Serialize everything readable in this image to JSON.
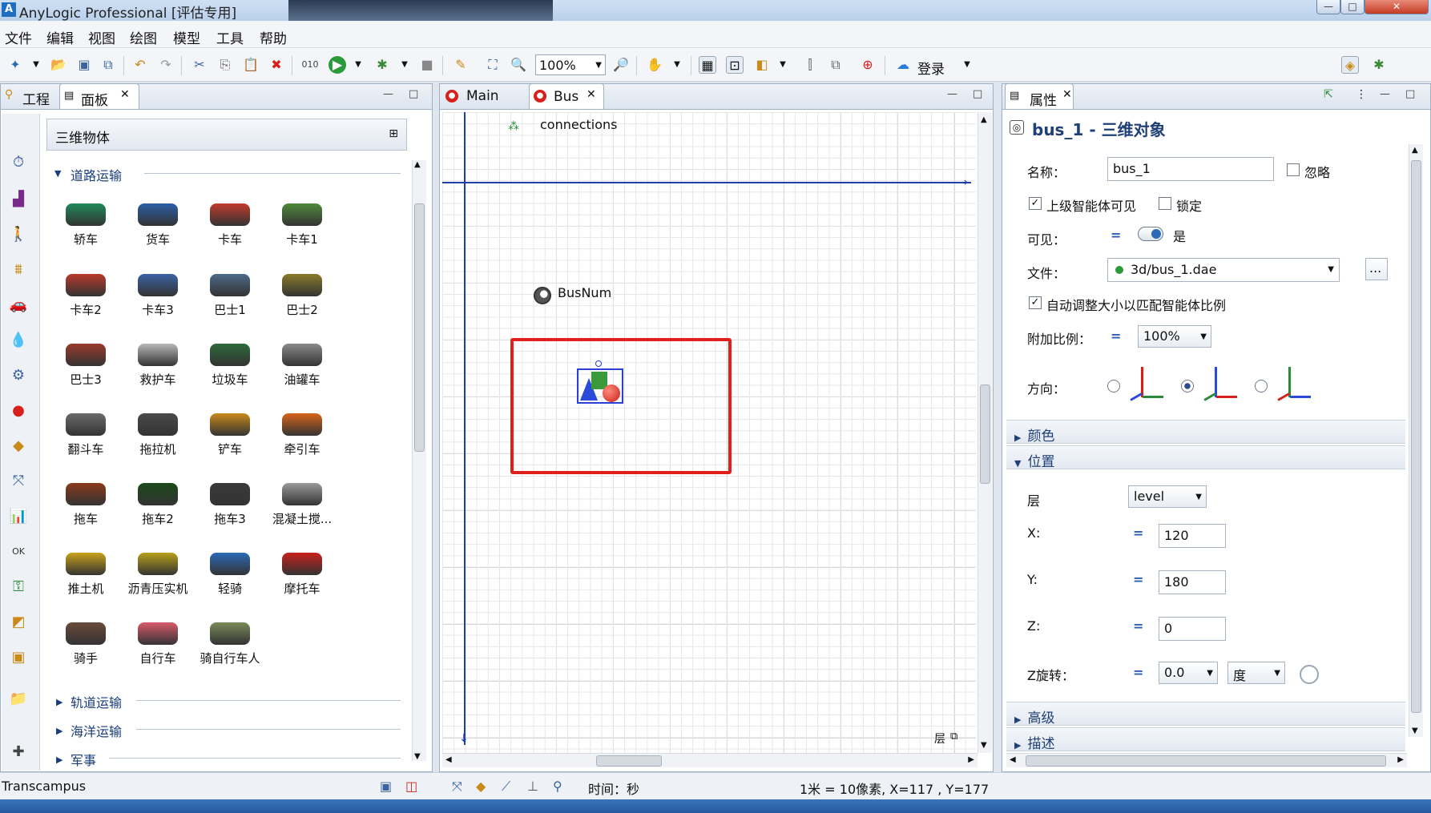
{
  "window": {
    "title": "AnyLogic Professional [评估专用]"
  },
  "menu": [
    "文件",
    "编辑",
    "视图",
    "绘图",
    "模型",
    "工具",
    "帮助"
  ],
  "toolbar": {
    "zoom": "100%",
    "login": "登录"
  },
  "left_panel": {
    "tabs": [
      "工程",
      "面板"
    ],
    "palette_title": "三维物体",
    "sections": {
      "road": "道路运输",
      "rail": "轨道运输",
      "sea": "海洋运输",
      "military": "军事"
    },
    "items": [
      {
        "label": "轿车",
        "color": "#1f8a5a"
      },
      {
        "label": "货车",
        "color": "#2b5fa6"
      },
      {
        "label": "卡车",
        "color": "#c23a2c"
      },
      {
        "label": "卡车1",
        "color": "#4f8a3a"
      },
      {
        "label": "卡车2",
        "color": "#b83a2c"
      },
      {
        "label": "卡车3",
        "color": "#3a63a3"
      },
      {
        "label": "巴士1",
        "color": "#4d6a8a"
      },
      {
        "label": "巴士2",
        "color": "#8a7a2a"
      },
      {
        "label": "巴士3",
        "color": "#9a3a2a"
      },
      {
        "label": "救护车",
        "color": "#b8b8b8"
      },
      {
        "label": "垃圾车",
        "color": "#2d6a3a"
      },
      {
        "label": "油罐车",
        "color": "#8a8a8a"
      },
      {
        "label": "翻斗车",
        "color": "#6b6b6b"
      },
      {
        "label": "拖拉机",
        "color": "#4a4a4a"
      },
      {
        "label": "铲车",
        "color": "#c98a1a"
      },
      {
        "label": "牵引车",
        "color": "#d8641a"
      },
      {
        "label": "拖车",
        "color": "#8a3a1a"
      },
      {
        "label": "拖车2",
        "color": "#1a4a1a"
      },
      {
        "label": "拖车3",
        "color": "#3a3a3a"
      },
      {
        "label": "混凝土搅...",
        "color": "#9a9a9a"
      },
      {
        "label": "推土机",
        "color": "#c9a21a"
      },
      {
        "label": "沥青压实机",
        "color": "#b8a01a"
      },
      {
        "label": "轻骑",
        "color": "#2a6ab8"
      },
      {
        "label": "摩托车",
        "color": "#c8201a"
      },
      {
        "label": "骑手",
        "color": "#6a4a3a"
      },
      {
        "label": "自行车",
        "color": "#d85a6a"
      },
      {
        "label": "骑自行车人",
        "color": "#7a8a5a"
      }
    ]
  },
  "center_panel": {
    "tabs": [
      "Main",
      "Bus"
    ],
    "canvas": {
      "connections_label": "connections",
      "param_label": "BusNum",
      "layers_label": "层"
    }
  },
  "right_panel": {
    "tab": "属性",
    "title": "bus_1 - 三维对象",
    "name_label": "名称：",
    "name_value": "bus_1",
    "ignore_label": "忽略",
    "upper_visible_label": "上级智能体可见",
    "lock_label": "锁定",
    "visible_label": "可见：",
    "visible_value": "是",
    "file_label": "文件：",
    "file_value": "3d/bus_1.dae",
    "browse_label": "...",
    "autoscale_label": "自动调整大小以匹配智能体比例",
    "scale_label": "附加比例：",
    "scale_value": "100%",
    "direction_label": "方向：",
    "sections": {
      "color": "颜色",
      "position": "位置",
      "advanced": "高级",
      "description": "描述"
    },
    "position": {
      "layer_label": "层",
      "layer_value": "level",
      "x_label": "X:",
      "x_value": "120",
      "y_label": "Y:",
      "y_value": "180",
      "z_label": "Z:",
      "z_value": "0",
      "zrot_label": "Z旋转：",
      "zrot_value": "0.0",
      "zrot_unit": "度"
    }
  },
  "statusbar": {
    "workspace": "Transcampus",
    "time_label": "时间：秒",
    "scale_info": "1米 = 10像素, X=117 , Y=177"
  }
}
